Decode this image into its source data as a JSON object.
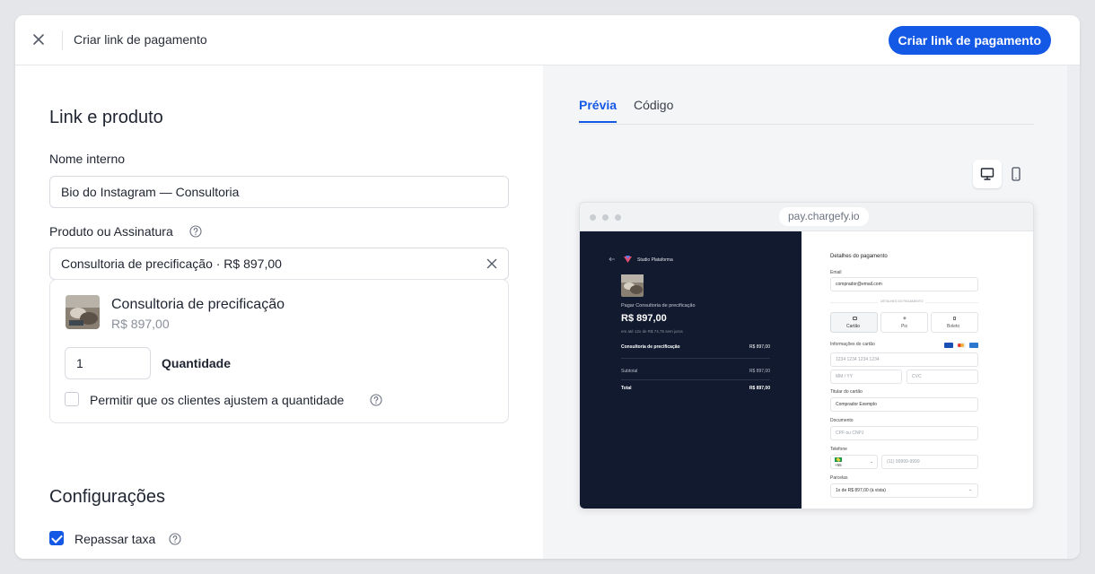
{
  "header": {
    "title": "Criar link de pagamento",
    "primary_button": "Criar link de pagamento",
    "accent_color": "#1458e6"
  },
  "form": {
    "section1_title": "Link e produto",
    "internal_name_label": "Nome interno",
    "internal_name_value": "Bio do Instagram — Consultoria",
    "product_label": "Produto ou Assinatura",
    "product_value": "Consultoria de precificação · R$ 897,00",
    "product_card": {
      "name": "Consultoria de precificação",
      "price": "R$ 897,00",
      "quantity": "1",
      "quantity_label": "Quantidade",
      "adjust_qty_label": "Permitir que os clientes ajustem a quantidade",
      "adjust_qty_checked": false
    },
    "section2_title": "Configurações",
    "pass_fee_label": "Repassar taxa",
    "pass_fee_checked": true
  },
  "preview": {
    "tabs": [
      {
        "label": "Prévia",
        "active": true
      },
      {
        "label": "Código",
        "active": false
      }
    ],
    "devices": [
      {
        "icon": "desktop-icon",
        "active": true
      },
      {
        "icon": "mobile-icon",
        "active": false
      }
    ],
    "url": "pay.chargefy.io",
    "checkout": {
      "brand": "Studio Plataforma",
      "pay_label": "Pagar Consultoria de precificação",
      "amount": "R$ 897,00",
      "installments_note": "em até 12x de R$ 74,75 sem juros",
      "line_item": "Consultoria de precificação",
      "line_amount": "R$ 897,00",
      "subtotal_label": "Subtotal",
      "subtotal_amount": "R$ 897,00",
      "total_label": "Total",
      "total_amount": "R$ 897,00",
      "details_title": "Detalhes do pagamento",
      "email_label": "Email",
      "email_value": "comprador@email.com",
      "divider_label": "DETALHES DO PAGAMENTO",
      "methods": [
        "Cartão",
        "Pix",
        "Boleto"
      ],
      "card_info_label": "Informações do cartão",
      "card_number_ph": "1234 1234 1234 1234",
      "expiry_ph": "MM / YY",
      "cvc_ph": "CVC",
      "holder_label": "Titular do cartão",
      "holder_value": "Comprador Exemplo",
      "document_label": "Documento",
      "document_ph": "CPF ou CNPJ",
      "phone_label": "Telefone",
      "phone_code": "+55",
      "phone_ph": "(11) 99999-9999",
      "installments_label": "Parcelas",
      "installments_value": "1x de R$ 897,00 (à vista)"
    }
  }
}
